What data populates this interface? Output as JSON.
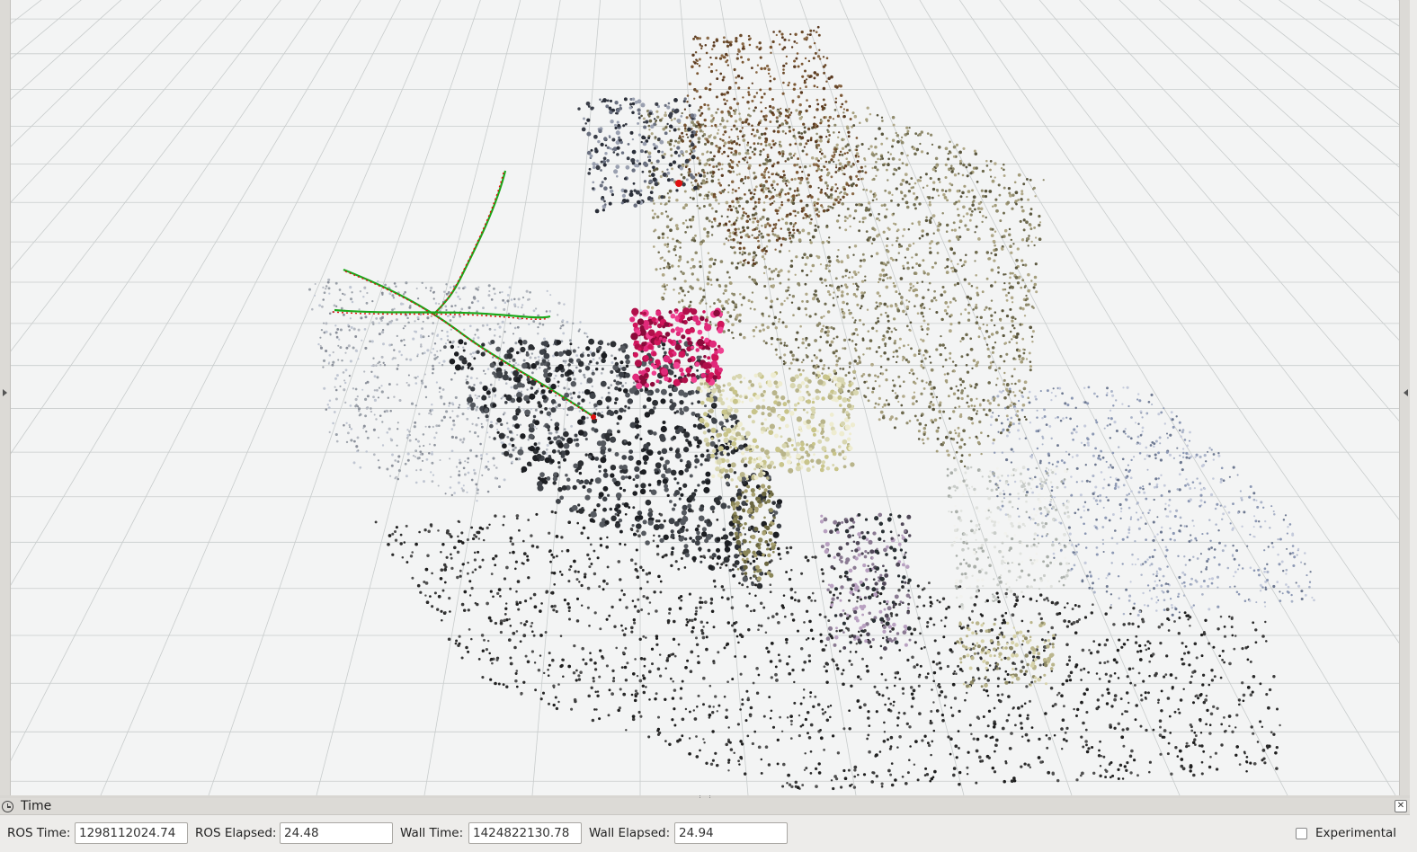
{
  "viewport": {
    "background": "#f3f4f4",
    "grid_color": "#c8cccc",
    "trajectory_colors": [
      "#1aa81a",
      "#e01010"
    ]
  },
  "time_panel": {
    "title": "Time",
    "icon": "clock-icon",
    "close_icon": "close-icon",
    "ros_time_label": "ROS Time:",
    "ros_time_value": "1298112024.74",
    "ros_elapsed_label": "ROS Elapsed:",
    "ros_elapsed_value": "24.48",
    "wall_time_label": "Wall Time:",
    "wall_time_value": "1424822130.78",
    "wall_elapsed_label": "Wall Elapsed:",
    "wall_elapsed_value": "24.94",
    "experimental_label": "Experimental",
    "experimental_checked": false
  }
}
